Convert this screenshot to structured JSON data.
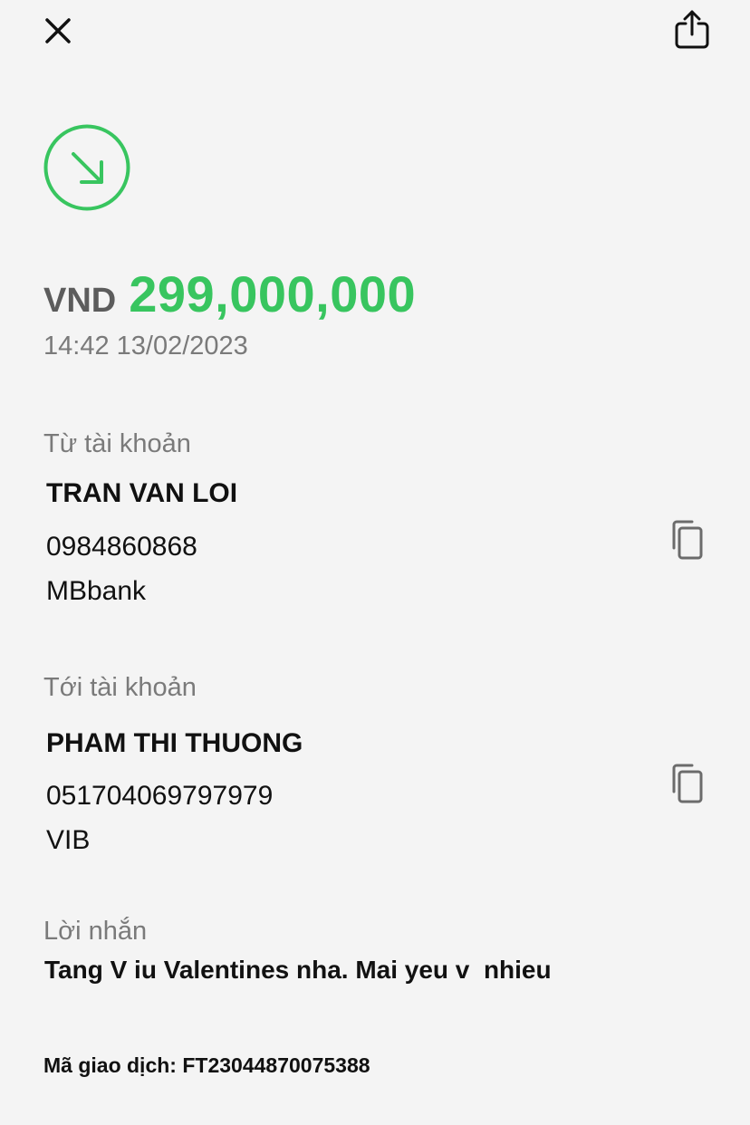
{
  "header": {
    "close_icon": "close-icon",
    "share_icon": "share-icon"
  },
  "status": {
    "icon": "arrow-down-right-icon",
    "color": "#38c55f"
  },
  "transaction": {
    "currency": "VND",
    "amount": "299,000,000",
    "datetime": "14:42 13/02/2023"
  },
  "from_account": {
    "label": "Từ tài khoản",
    "name": "TRAN VAN LOI",
    "number": "0984860868",
    "bank": "MBbank"
  },
  "to_account": {
    "label": "Tới tài khoản",
    "name": "PHAM THI THUONG",
    "number": "051704069797979",
    "bank": "VIB"
  },
  "message": {
    "label": "Lời nhắn",
    "text": "Tang V iu Valentines nha. Mai yeu v  nhieu"
  },
  "reference": {
    "label": "Mã giao dịch:",
    "code": "FT23044870075388"
  },
  "colors": {
    "background": "#f4f4f4",
    "accent_green": "#38c55f",
    "muted_text": "#7a7a7a",
    "primary_text": "#111111"
  }
}
